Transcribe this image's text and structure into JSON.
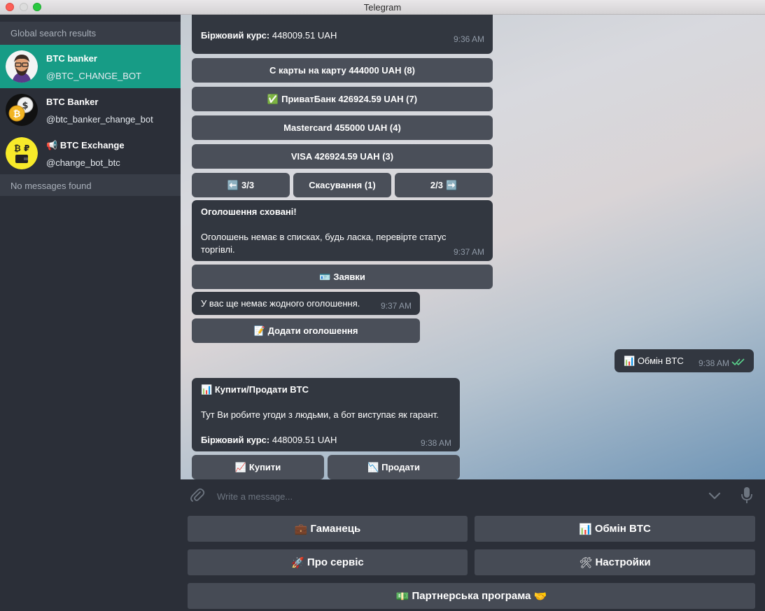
{
  "window": {
    "title": "Telegram"
  },
  "sidebar": {
    "header": "Global search results",
    "results": [
      {
        "name": "BTC banker",
        "handle": "@BTC_CHANGE_BOT",
        "active": true,
        "icon": "bot-avatar-man"
      },
      {
        "name": "BTC Banker",
        "handle": "@btc_banker_change_bot",
        "active": false,
        "icon": "bitcoin-coins-avatar"
      },
      {
        "name": "BTC Exchange",
        "name_icon": "megaphone-icon",
        "handle": "@change_bot_btc",
        "active": false,
        "icon": "bitcoin-ruble-wallet-avatar"
      }
    ],
    "no_messages": "No messages found"
  },
  "chat": {
    "msg1": {
      "rate_label": "Біржовий курс:",
      "rate_value": "448009.51 UAH",
      "time": "9:36 AM"
    },
    "offers": [
      {
        "label": "С карты на карту 444000 UAH (8)"
      },
      {
        "emoji": "✅",
        "label": "ПриватБанк 426924.59 UAH (7)"
      },
      {
        "label": "Mastercard 455000 UAH (4)"
      },
      {
        "label": "VISA 426924.59 UAH (3)"
      }
    ],
    "nav": {
      "prev_emoji": "⬅️",
      "prev": "3/3",
      "cancel": "Скасування (1)",
      "next": "2/3",
      "next_emoji": "➡️"
    },
    "msg2": {
      "title": "Оголошення сховані!",
      "body": "Оголошень немає в списках, будь ласка, перевірте статус торгівлі.",
      "time": "9:37 AM"
    },
    "orders_button": {
      "emoji": "🪪",
      "label": "Заявки"
    },
    "msg3": {
      "text": "У вас ще немає жодного оголошення.",
      "time": "9:37 AM"
    },
    "add_button": {
      "emoji": "📝",
      "label": "Додати оголошення"
    },
    "outgoing": {
      "emoji": "📊",
      "text": "Обмін BTC",
      "time": "9:38 AM",
      "status_icon": "double-check-icon",
      "status_color": "#5ad28c"
    },
    "msg4": {
      "emoji": "📊",
      "title": "Купити/Продати BTC",
      "body": "Тут Ви робите угоди з людьми, а бот виступає як гарант.",
      "rate_label": "Біржовий курс:",
      "rate_value": "448009.51 UAH",
      "time": "9:38 AM"
    },
    "buy_button": {
      "emoji": "📈",
      "label": "Купити"
    },
    "sell_button": {
      "emoji": "📉",
      "label": "Продати"
    }
  },
  "input": {
    "placeholder": "Write a message..."
  },
  "reply_keyboard": [
    {
      "emoji": "💼",
      "label": "Гаманець"
    },
    {
      "emoji": "📊",
      "label": "Обмін BTC"
    },
    {
      "emoji": "🚀",
      "label": "Про сервіс"
    },
    {
      "emoji": "🛠",
      "label": "Настройки"
    },
    {
      "emoji": "💵",
      "label": "Партнерська програма",
      "emoji_after": "🤝"
    }
  ],
  "colors": {
    "accent": "#179c86",
    "bubble": "#323740",
    "button": "#4a4f59",
    "sidebar": "#2b2f38"
  }
}
